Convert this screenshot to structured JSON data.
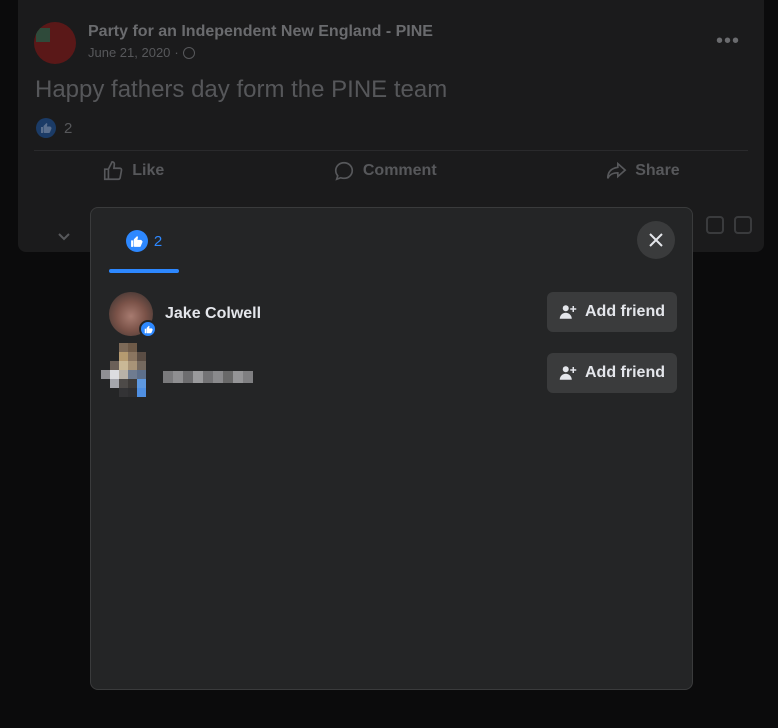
{
  "post": {
    "page_name": "Party for an Independent New England - PINE",
    "date": "June 21, 2020",
    "date_sep": "·",
    "text": "Happy fathers day form the PINE team",
    "reaction_count": "2",
    "actions": {
      "like": "Like",
      "comment": "Comment",
      "share": "Share"
    }
  },
  "modal": {
    "tab_count": "2",
    "people": [
      {
        "name": "Jake Colwell",
        "button_label": "Add friend",
        "reaction": "like"
      },
      {
        "name": "",
        "button_label": "Add friend",
        "redacted": true
      }
    ]
  },
  "colors": {
    "accent": "#2d88ff",
    "modal_bg": "#242526",
    "button_bg": "#3a3b3c",
    "text_primary": "#e4e6eb"
  },
  "icons": [
    "like-icon",
    "comment-icon",
    "share-icon",
    "globe-icon",
    "close-icon",
    "add-friend-icon",
    "more-icon"
  ]
}
